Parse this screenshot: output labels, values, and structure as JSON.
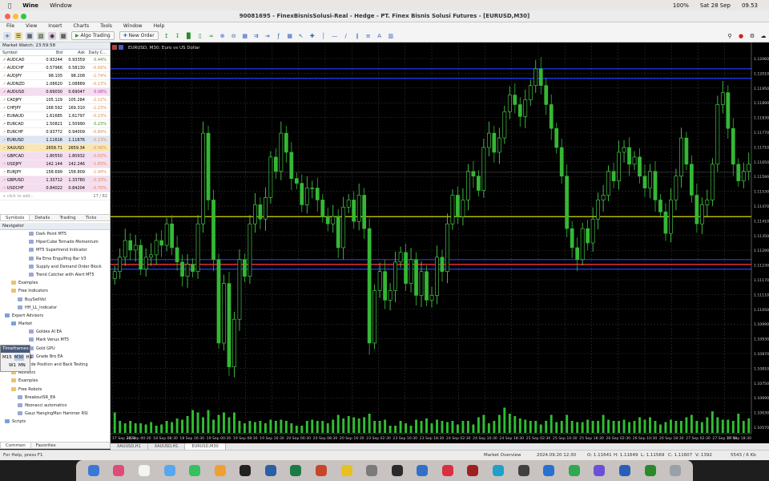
{
  "macbar": {
    "apple": "",
    "app": "Wine",
    "menu": "Window",
    "status_items": [
      "100%",
      "Sat 28 Sep",
      "09.53"
    ]
  },
  "window": {
    "title": "90081695 - FinexBisnisSolusi-Real - Hedge - PT. Finex Bisnis Solusi Futures - [EURUSD,M30]"
  },
  "menu": [
    "File",
    "View",
    "Insert",
    "Charts",
    "Tools",
    "Window",
    "Help"
  ],
  "toolbar": {
    "algo_label": "Algo Trading",
    "order_label": "New Order"
  },
  "market_watch": {
    "title": "Market Watch: 23:59:58",
    "columns": [
      "Symbol",
      "Bid",
      "Ask",
      "Daily C..."
    ],
    "rows": [
      {
        "symbol": "AUDCAD",
        "bid": "0.93244",
        "ask": "0.93359",
        "change": "0.44%",
        "bg": "#ffffff",
        "color": "#4a8a2e"
      },
      {
        "symbol": "AUDCHF",
        "bid": "0.57966",
        "ask": "0.58130",
        "change": "-0.69%",
        "bg": "#ffffff",
        "color": "#e08a4a"
      },
      {
        "symbol": "AUDJPY",
        "bid": "98.105",
        "ask": "98.208",
        "change": "-1.74%",
        "bg": "#ffffff",
        "color": "#e08a4a"
      },
      {
        "symbol": "AUDNZD",
        "bid": "1.08620",
        "ask": "1.08889",
        "change": "-0.13%",
        "bg": "#ffffff",
        "color": "#e08a4a"
      },
      {
        "symbol": "AUDUSD",
        "bid": "0.69030",
        "ask": "0.69047",
        "change": "0.08%",
        "bg": "#f5ddf0",
        "color": "#b040a0"
      },
      {
        "symbol": "CADJPY",
        "bid": "105.129",
        "ask": "105.284",
        "change": "-2.22%",
        "bg": "#ffffff",
        "color": "#e08a4a"
      },
      {
        "symbol": "CHFJPY",
        "bid": "168.592",
        "ask": "169.310",
        "change": "-1.23%",
        "bg": "#ffffff",
        "color": "#e08a4a"
      },
      {
        "symbol": "EURAUD",
        "bid": "1.61685",
        "ask": "1.61797",
        "change": "-0.23%",
        "bg": "#ffffff",
        "color": "#e08a4a"
      },
      {
        "symbol": "EURCAD",
        "bid": "1.50821",
        "ask": "1.50990",
        "change": "0.23%",
        "bg": "#ffffff",
        "color": "#4a8a2e"
      },
      {
        "symbol": "EURCHF",
        "bid": "0.93772",
        "ask": "0.94009",
        "change": "-0.84%",
        "bg": "#ffffff",
        "color": "#e08a4a"
      },
      {
        "symbol": "EURUSD",
        "bid": "1.11616",
        "ask": "1.11676",
        "change": "-0.13%",
        "bg": "#dfe6f3",
        "color": "#e08a4a"
      },
      {
        "symbol": "XAUUSD",
        "bid": "2658.71",
        "ask": "2659.34",
        "change": "-0.56%",
        "bg": "#f8e6b4",
        "color": "#e08a4a"
      },
      {
        "symbol": "GBPCAD",
        "bid": "1.80550",
        "ask": "1.80932",
        "change": "-0.02%",
        "bg": "#f5ddf0",
        "color": "#e08a4a"
      },
      {
        "symbol": "USDJPY",
        "bid": "142.144",
        "ask": "142.246",
        "change": "-1.83%",
        "bg": "#f5ddf0",
        "color": "#e08a4a"
      },
      {
        "symbol": "EURJPY",
        "bid": "158.699",
        "ask": "158.809",
        "change": "-1.94%",
        "bg": "#ffffff",
        "color": "#e08a4a"
      },
      {
        "symbol": "GBPUSD",
        "bid": "1.33712",
        "ask": "1.33780",
        "change": "-0.33%",
        "bg": "#f5ddf0",
        "color": "#e08a4a"
      },
      {
        "symbol": "USDCHF",
        "bid": "0.84022",
        "ask": "0.84204",
        "change": "-0.70%",
        "bg": "#f5ddf0",
        "color": "#e08a4a"
      }
    ],
    "add_label": "+ click to add...",
    "count": "17 / 82",
    "tabs": [
      "Symbols",
      "Details",
      "Trading",
      "Ticks"
    ]
  },
  "navigator": {
    "title": "Navigator",
    "items": [
      {
        "label": "Dark Point MT5",
        "indent": 36,
        "icon": "#9aa7d6"
      },
      {
        "label": "HiperCube Tornado Momentum",
        "indent": 36,
        "icon": "#9aa7d6"
      },
      {
        "label": "MT5 Supertrend Indicator",
        "indent": 36,
        "icon": "#9aa7d6"
      },
      {
        "label": "Ra Ema Engulfing Bar V3",
        "indent": 36,
        "icon": "#9aa7d6"
      },
      {
        "label": "Supply and Demand Order Block",
        "indent": 36,
        "icon": "#9aa7d6"
      },
      {
        "label": "Trend Catcher with Alert MT5",
        "indent": 36,
        "icon": "#9aa7d6"
      },
      {
        "label": "Examples",
        "indent": 14,
        "icon": "#e8c46a"
      },
      {
        "label": "Free Indicators",
        "indent": 14,
        "icon": "#e8c46a"
      },
      {
        "label": "BuySellVol",
        "indent": 22,
        "icon": "#9aa7d6"
      },
      {
        "label": "HH_LL_Indicator",
        "indent": 22,
        "icon": "#9aa7d6"
      },
      {
        "label": "Expert Advisors",
        "indent": 6,
        "icon": "#7aa0d8"
      },
      {
        "label": "Market",
        "indent": 14,
        "icon": "#7aa0d8"
      },
      {
        "label": "Goldex AI EA",
        "indent": 36,
        "icon": "#9aa7d6"
      },
      {
        "label": "Mark Venus MT5",
        "indent": 36,
        "icon": "#9aa7d6"
      },
      {
        "label": "Gold GPU",
        "indent": 36,
        "icon": "#9aa7d6"
      },
      {
        "label": "Grade Bro EA",
        "indent": 36,
        "icon": "#9aa7d6"
      },
      {
        "label": "Trade Position and Back Testing",
        "indent": 22,
        "icon": "#9aa7d6"
      },
      {
        "label": "Advisors",
        "indent": 14,
        "icon": "#e8c46a"
      },
      {
        "label": "Examples",
        "indent": 14,
        "icon": "#e8c46a"
      },
      {
        "label": "Free Robots",
        "indent": 14,
        "icon": "#e8c46a"
      },
      {
        "label": "BreakoutSR_EA",
        "indent": 22,
        "icon": "#9aa7d6"
      },
      {
        "label": "fibonacci automatico",
        "indent": 22,
        "icon": "#9aa7d6"
      },
      {
        "label": "Gauz HangingMan Hammer RSI",
        "indent": 22,
        "icon": "#9aa7d6"
      },
      {
        "label": "Scripts",
        "indent": 6,
        "icon": "#7aa0d8"
      }
    ],
    "tabs": [
      "Common",
      "Favorites"
    ]
  },
  "timeframe_popup": {
    "title": "Timeframes",
    "row1": [
      "M15",
      "M30",
      "H1"
    ],
    "row2": [
      "W1",
      "MN"
    ]
  },
  "chart_data": {
    "type": "candlestick",
    "label": "EURUSD, M30: Euro vs US Dollar",
    "price_labels": [
      "1.12060",
      "1.12010",
      "1.11950",
      "1.11890",
      "1.11830",
      "1.11770",
      "1.11710",
      "1.11650",
      "1.11590",
      "1.11530",
      "1.11470",
      "1.11410",
      "1.11350",
      "1.11290",
      "1.11230",
      "1.11170",
      "1.11110",
      "1.11050",
      "1.10990",
      "1.10930",
      "1.10870",
      "1.10810",
      "1.10750",
      "1.10690",
      "1.10630",
      "1.10570"
    ],
    "date_labels": [
      "17 Sep 2024",
      "18 Sep 00:30",
      "18 Sep 08:30",
      "18 Sep 16:30",
      "19 Sep 00:30",
      "19 Sep 08:30",
      "19 Sep 16:30",
      "20 Sep 00:30",
      "20 Sep 08:30",
      "20 Sep 16:30",
      "23 Sep 02:30",
      "23 Sep 10:30",
      "23 Sep 18:30",
      "24 Sep 02:30",
      "24 Sep 10:30",
      "24 Sep 18:30",
      "25 Sep 02:30",
      "25 Sep 10:30",
      "25 Sep 18:30",
      "26 Sep 02:30",
      "26 Sep 10:30",
      "26 Sep 18:30",
      "27 Sep 02:30",
      "27 Sep 10:30",
      "27 Sep 18:30"
    ],
    "ylim": [
      1.1052,
      1.1212
    ],
    "current_price": "1.11616",
    "hlines": [
      {
        "price": 1.1205,
        "color": "#2040ff"
      },
      {
        "price": 1.1201,
        "color": "#2040ff"
      },
      {
        "price": 1.1143,
        "color": "#d8d800"
      },
      {
        "price": 1.1125,
        "color": "#2040ff"
      },
      {
        "price": 1.1123,
        "color": "#ff3030"
      },
      {
        "price": 1.1121,
        "color": "#2040ff"
      }
    ],
    "closes": [
      1.112,
      1.1126,
      1.1133,
      1.1129,
      1.1131,
      1.1121,
      1.1126,
      1.1127,
      1.1133,
      1.1131,
      1.114,
      1.113,
      1.1124,
      1.1118,
      1.1123,
      1.112,
      1.114,
      1.1178,
      1.115,
      1.1125,
      1.109,
      1.1115,
      1.108,
      1.11,
      1.1125,
      1.1118,
      1.114,
      1.1148,
      1.1142,
      1.1151,
      1.1168,
      1.1162,
      1.1178,
      1.117,
      1.1159,
      1.1157,
      1.1148,
      1.1155,
      1.1155,
      1.115,
      1.1143,
      1.114,
      1.1143,
      1.113,
      1.1147,
      1.115,
      1.1141,
      1.1152,
      1.1138,
      1.109,
      1.1112,
      1.112,
      1.1108,
      1.1112,
      1.1124,
      1.1128,
      1.1115,
      1.1125,
      1.111,
      1.112,
      1.1108,
      1.111,
      1.1126,
      1.112,
      1.114,
      1.1152,
      1.1143,
      1.115,
      1.1162,
      1.116,
      1.1154,
      1.1172,
      1.1178,
      1.117,
      1.1176,
      1.1187,
      1.1194,
      1.119,
      1.1185,
      1.1192,
      1.1198,
      1.1205,
      1.1198,
      1.119,
      1.118,
      1.1172,
      1.116,
      1.1138,
      1.113,
      1.1125,
      1.1138,
      1.1132,
      1.1142,
      1.115,
      1.1152,
      1.1162,
      1.1158,
      1.117,
      1.1172,
      1.1165,
      1.1168,
      1.116,
      1.1155,
      1.1162,
      1.115,
      1.1145,
      1.1136,
      1.115,
      1.116,
      1.1176,
      1.1165,
      1.1152,
      1.114,
      1.1148,
      1.115,
      1.1165,
      1.119,
      1.1195,
      1.118,
      1.1165,
      1.1158,
      1.1162,
      1.1165
    ],
    "volumes": [
      34,
      20,
      16,
      20,
      16,
      16,
      14,
      18,
      12,
      14,
      20,
      18,
      24,
      22,
      28,
      38,
      34,
      26,
      38,
      22,
      30,
      34,
      26,
      34,
      20,
      16,
      20,
      18,
      20,
      16,
      22,
      20,
      22,
      20,
      16,
      12,
      12,
      20,
      22,
      20,
      20,
      16,
      22,
      30,
      24,
      28,
      26,
      24,
      26,
      32,
      20,
      20,
      22,
      12,
      12,
      20,
      16,
      12,
      22,
      20,
      24,
      16,
      22,
      20,
      18,
      20,
      14,
      20,
      20,
      14,
      26,
      30,
      16,
      20,
      30,
      42,
      32,
      28,
      24,
      22,
      20,
      20,
      14,
      20,
      30,
      18,
      20,
      30,
      20,
      18,
      18,
      22,
      20,
      20,
      30,
      22,
      20,
      20,
      22,
      18,
      20,
      26,
      22,
      26,
      20,
      14,
      18,
      22,
      20,
      20,
      26,
      30,
      20,
      18,
      26,
      36,
      26,
      22,
      22,
      20,
      32,
      20,
      24,
      28,
      22
    ]
  },
  "bottom_tabs": [
    "XAUUSD,H1",
    "XAUUSD,H1",
    "EURUSD,M30"
  ],
  "statusbar": {
    "help": "For Help, press F1",
    "overview": "Market Overview",
    "datetime": "2024.09.20 12:30",
    "open": "O: 1.11641",
    "high": "H: 1.11649",
    "low": "L: 1.11569",
    "close": "C: 1.11607",
    "volume": "V: 1392",
    "traffic": "5543 / 6 Kb"
  }
}
